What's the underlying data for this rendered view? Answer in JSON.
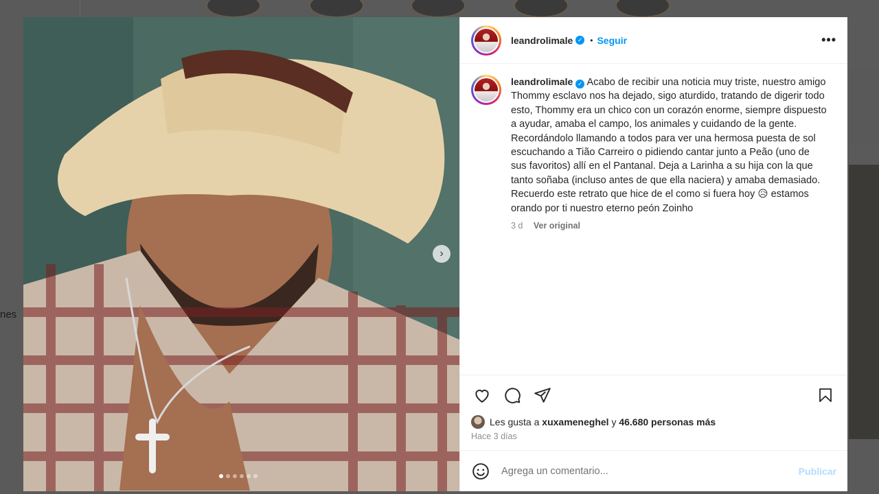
{
  "background": {
    "side_text": "nes"
  },
  "post": {
    "username": "leandrolimale",
    "separator": "•",
    "follow_label": "Seguir",
    "more_label": "•••",
    "caption": "Acabo de recibir una noticia muy triste, nuestro amigo Thommy esclavo nos ha dejado, sigo aturdido, tratando de digerir todo esto, Thommy era un chico con un corazón enorme, siempre dispuesto a ayudar, amaba el campo, los animales y cuidando de la gente. Recordándolo llamando a todos para ver una hermosa puesta de sol escuchando a Tião Carreiro o pidiendo cantar junto a Peão (uno de sus favoritos) allí en el Pantanal. Deja a Larinha a su hija con la que tanto soñaba (incluso antes de que ella naciera) y amaba demasiado. Recuerdo este retrato que hice de el como si fuera hoy 😥 estamos orando por ti nuestro eterno peón Zoinho",
    "caption_age": "3 d",
    "see_original": "Ver original",
    "likes_prefix": "Les gusta a ",
    "likes_user": "xuxameneghel",
    "likes_mid": " y ",
    "likes_count": "46.680 personas más",
    "posted_ago": "Hace 3 días",
    "comment_placeholder": "Agrega un comentario...",
    "publish_label": "Publicar",
    "carousel": {
      "total": 6,
      "active": 1
    }
  },
  "colors": {
    "link": "#0095f6",
    "publish_disabled": "#b3dbff"
  },
  "icons": [
    "heart-icon",
    "comment-icon",
    "share-icon",
    "bookmark-icon",
    "emoji-icon",
    "chevron-right-icon",
    "verified-icon"
  ]
}
